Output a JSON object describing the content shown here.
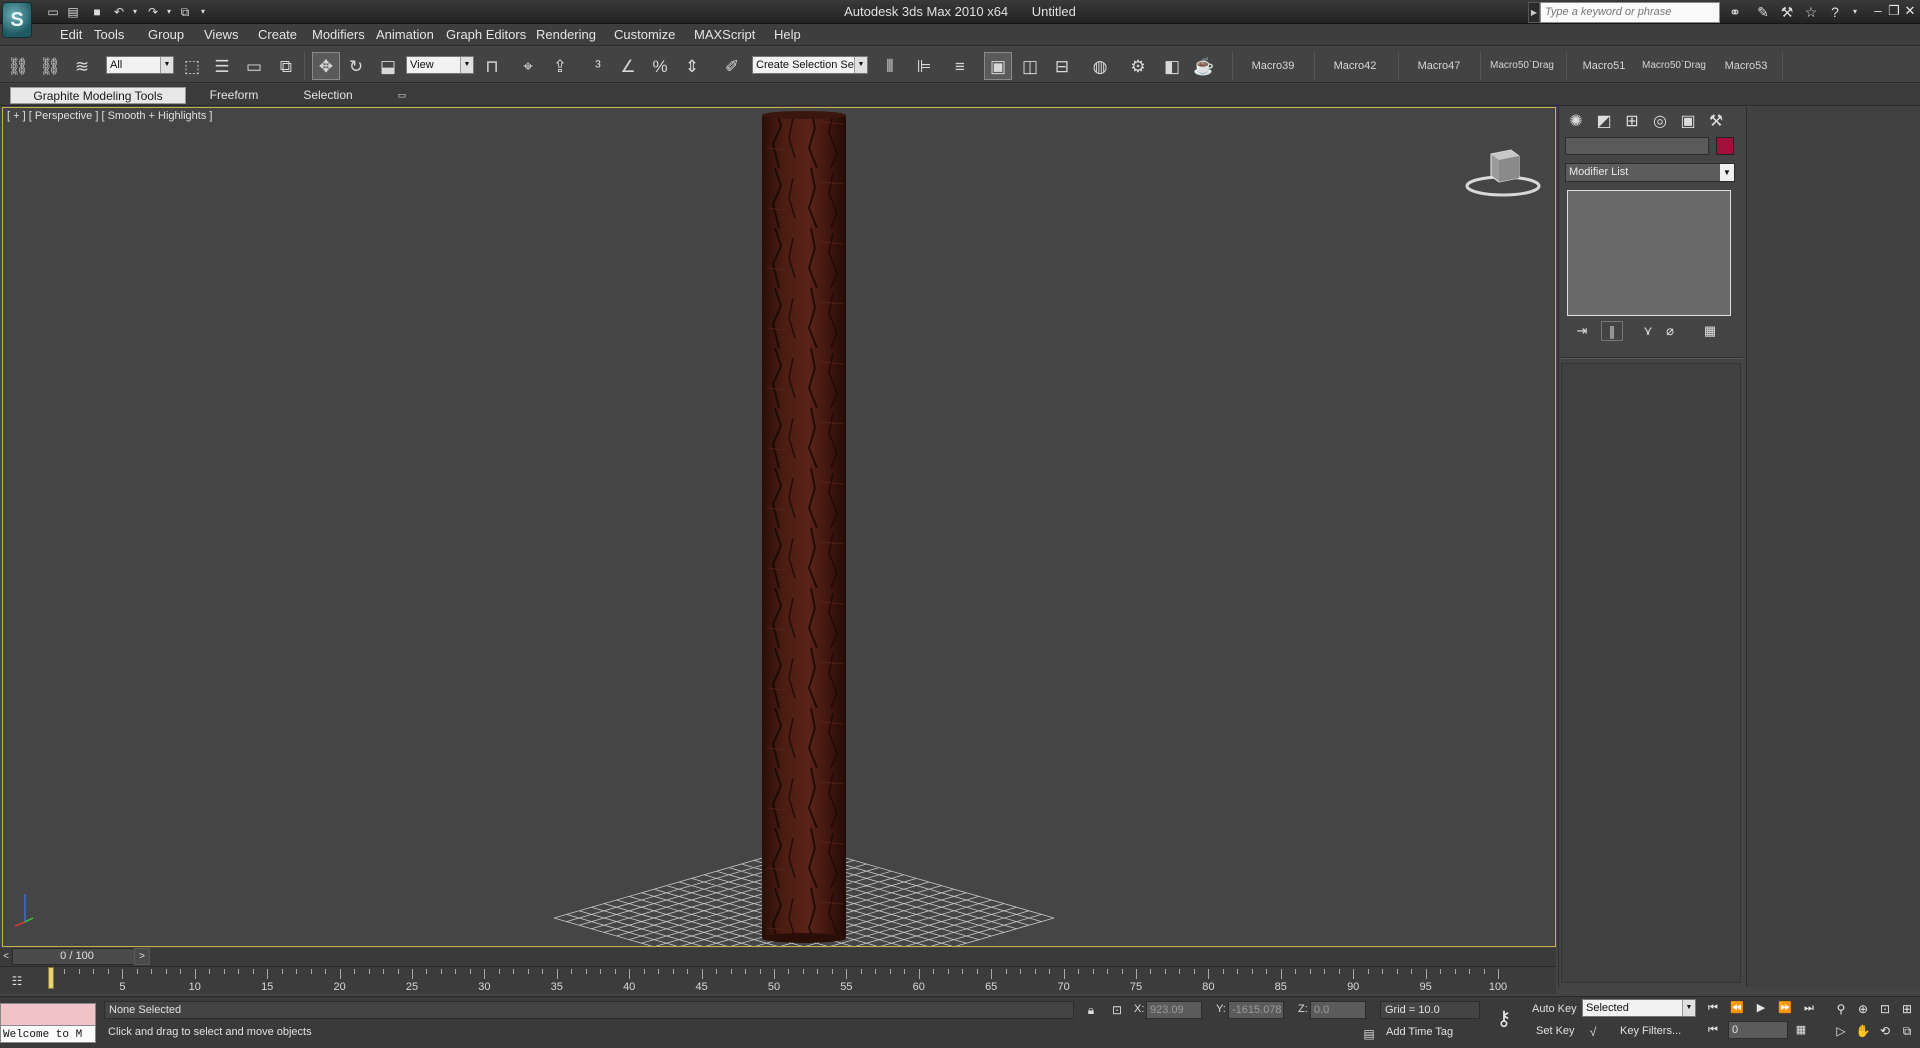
{
  "title_bar": {
    "app_name": "Autodesk 3ds Max  2010 x64",
    "document": "Untitled",
    "search_placeholder": "Type a keyword or phrase",
    "quick_access": [
      "new-icon",
      "open-icon",
      "save-icon",
      "undo-icon",
      "redo-icon",
      "project-folder-icon"
    ],
    "logo_glyph": "S"
  },
  "menu": {
    "items": [
      "Edit",
      "Tools",
      "Group",
      "Views",
      "Create",
      "Modifiers",
      "Animation",
      "Graph Editors",
      "Rendering",
      "Customize",
      "MAXScript",
      "Help"
    ]
  },
  "toolbar": {
    "selection_filter": "All",
    "ref_coord_system": "View",
    "named_selection_sets": "Create Selection Se",
    "macros": [
      "Macro39",
      "Macro42",
      "Macro47",
      "Macro50`Drag",
      "Macro51",
      "Macro50`Drag",
      "Macro53"
    ]
  },
  "ribbon": {
    "tabs": [
      "Graphite Modeling Tools",
      "Freeform",
      "Selection"
    ]
  },
  "viewport": {
    "label": "[ + ] [ Perspective ] [ Smooth + Highlights ]",
    "object_material": "bark-texture",
    "colors": {
      "bark_dark": "#2a0e08",
      "bark_mid": "#5a2418",
      "bark_light": "#7a3a28",
      "viewport_border": "#c8b04a"
    }
  },
  "command_panel": {
    "modifier_list": "Modifier List",
    "object_color": "#a0103a",
    "tabs": [
      "create-icon",
      "modify-icon",
      "hierarchy-icon",
      "motion-icon",
      "display-icon",
      "utilities-icon"
    ]
  },
  "time_slider": {
    "position_text": "0 / 100",
    "prev_glyph": "<",
    "next_glyph": ">"
  },
  "track_bar": {
    "labels": [
      "5",
      "10",
      "15",
      "20",
      "25",
      "30",
      "35",
      "40",
      "45",
      "50",
      "55",
      "60",
      "65",
      "70",
      "75",
      "80",
      "85",
      "90",
      "95",
      "100"
    ]
  },
  "status_bar": {
    "listener_text": "Welcome to M",
    "selection_status": "None Selected",
    "prompt": "Click and drag to select and move objects",
    "x_label": "X:",
    "x_value": "923.09",
    "y_label": "Y:",
    "y_value": "-1615.078",
    "z_label": "Z:",
    "z_value": "0.0",
    "grid": "Grid = 10.0",
    "add_time_tag": "Add Time Tag",
    "auto_key": "Auto Key",
    "set_key": "Set Key",
    "key_mode": "Selected",
    "key_filters": "Key Filters...",
    "current_frame": "0"
  }
}
